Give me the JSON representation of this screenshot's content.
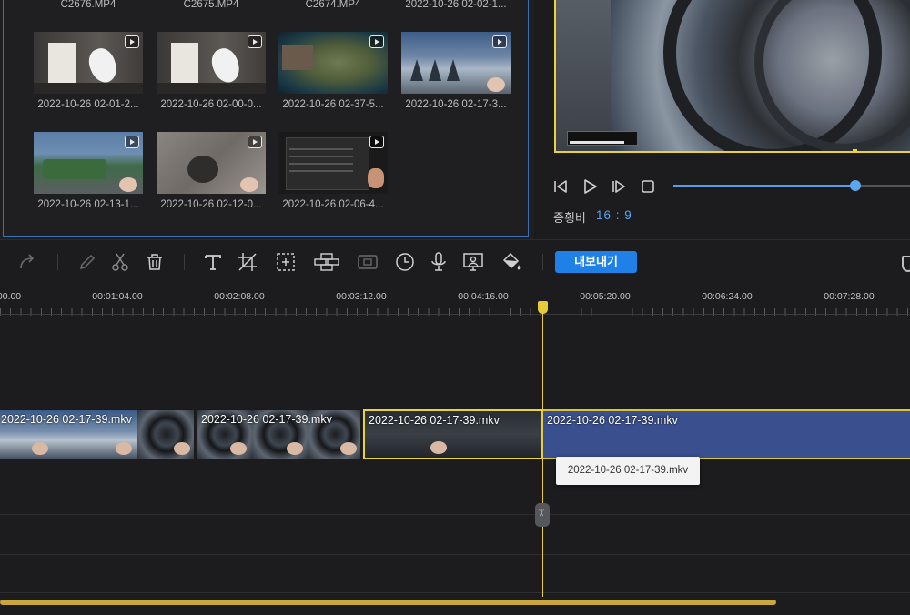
{
  "media_library": {
    "top_row_names": [
      "C2676.MP4",
      "C2675.MP4",
      "C2674.MP4",
      "2022-10-26 02-02-1..."
    ],
    "items": [
      {
        "name": "2022-10-26 02-01-2..."
      },
      {
        "name": "2022-10-26 02-00-0..."
      },
      {
        "name": "2022-10-26 02-37-5..."
      },
      {
        "name": "2022-10-26 02-17-3..."
      },
      {
        "name": "2022-10-26 02-13-1..."
      },
      {
        "name": "2022-10-26 02-12-0..."
      },
      {
        "name": "2022-10-26 02-06-4..."
      }
    ]
  },
  "preview": {
    "ratio_label": "종횡비",
    "ratio_value": "16 : 9",
    "playback_progress": 0.77
  },
  "toolbar": {
    "export_label": "내보내기"
  },
  "timeline": {
    "ruler_labels": [
      "00.00",
      "00:01:04.00",
      "00:02:08.00",
      "00:03:12.00",
      "00:04:16.00",
      "00:05:20.00",
      "00:06:24.00",
      "00:07:28.00"
    ],
    "clips": [
      {
        "name": "2022-10-26 02-17-39.mkv"
      },
      {
        "name": "2022-10-26 02-17-39.mkv"
      },
      {
        "name": "2022-10-26 02-17-39.mkv"
      },
      {
        "name": "2022-10-26 02-17-39.mkv"
      }
    ],
    "tooltip": "2022-10-26 02-17-39.mkv"
  },
  "colors": {
    "accent": "#1f80e8",
    "playhead": "#e8c93a",
    "selection": "#e8d33a",
    "ratio_text": "#57a3f0"
  }
}
